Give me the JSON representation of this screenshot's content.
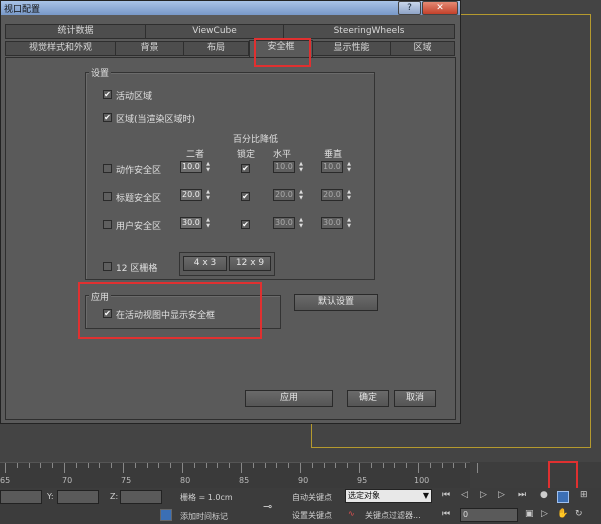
{
  "dialog": {
    "title": "视口配置",
    "help_label": "?",
    "close_label": "✕",
    "tabs_row1": [
      "统计数据",
      "ViewCube",
      "SteeringWheels"
    ],
    "tabs_row2": [
      "视觉样式和外观",
      "背景",
      "布局",
      "安全框",
      "显示性能",
      "区域"
    ],
    "active_tab": "安全框"
  },
  "settings": {
    "group_label": "设置",
    "live_area": {
      "label": "活动区域",
      "checked": true
    },
    "region": {
      "label": "区域(当渲染区域时)",
      "checked": true
    },
    "percent_header": "百分比降低",
    "col_both": "二者",
    "col_lock": "锁定",
    "col_horiz": "水平",
    "col_vert": "垂直",
    "rows": [
      {
        "label": "动作安全区",
        "both": "10.0",
        "horiz": "10.0",
        "vert": "10.0"
      },
      {
        "label": "标题安全区",
        "both": "20.0",
        "horiz": "20.0",
        "vert": "20.0"
      },
      {
        "label": "用户安全区",
        "both": "30.0",
        "horiz": "30.0",
        "vert": "30.0"
      }
    ],
    "grid12": {
      "label": "12 区栅格",
      "opt1": "4 x 3",
      "opt2": "12 x 9"
    }
  },
  "apply_group": {
    "label": "应用",
    "show_in_active": {
      "label": "在活动视图中显示安全框",
      "checked": true
    }
  },
  "buttons": {
    "defaults": "默认设置",
    "apply": "应用",
    "ok": "确定",
    "cancel": "取消"
  },
  "timeline": {
    "ticks": [
      "65",
      "70",
      "75",
      "80",
      "85",
      "90",
      "95",
      "100"
    ]
  },
  "statusbar": {
    "y_label": "Y:",
    "z_label": "Z:",
    "grid": "栅格 = 1.0cm",
    "add_time_tag": "添加时间标记",
    "auto_key": "自动关键点",
    "set_key": "设置关键点",
    "selected": "选定对象",
    "key_filters": "关键点过滤器...",
    "frame": "0"
  },
  "colors": {
    "highlight": "#e03030",
    "dialog_bg": "#5a5a5a",
    "title_bar": "#8fa9d6"
  }
}
